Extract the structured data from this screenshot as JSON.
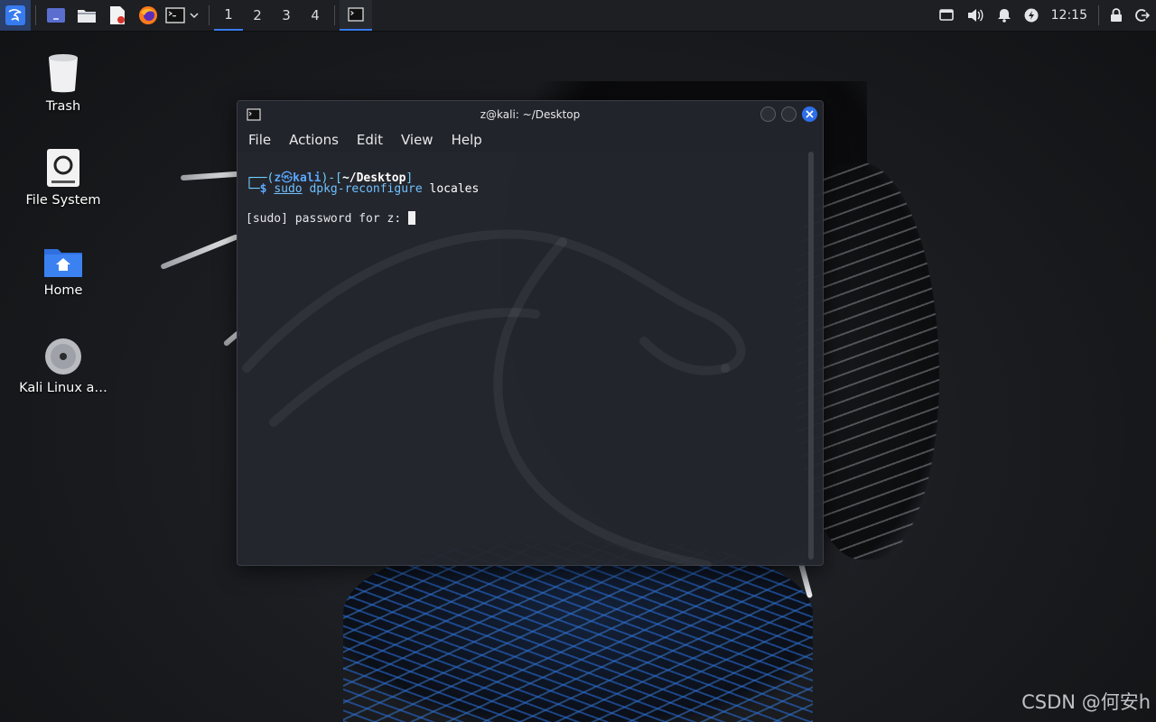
{
  "panel": {
    "workspaces": [
      "1",
      "2",
      "3",
      "4"
    ],
    "active_workspace": "1",
    "clock": "12:15",
    "accent": "#367bf0"
  },
  "desktop": {
    "icons": [
      {
        "label": "Trash",
        "icon": "trash-icon"
      },
      {
        "label": "File System",
        "icon": "drive-icon"
      },
      {
        "label": "Home",
        "icon": "home-folder-icon"
      },
      {
        "label": "Kali Linux a…",
        "icon": "disc-icon"
      }
    ]
  },
  "terminal": {
    "title": "z@kali: ~/Desktop",
    "menu": [
      "File",
      "Actions",
      "Edit",
      "View",
      "Help"
    ],
    "prompt": {
      "open": "┌──(",
      "user": "z",
      "skull": "㉿",
      "host": "kali",
      "mid": ")-[",
      "path": "~/Desktop",
      "close": "]",
      "corner": "└─",
      "dollar": "$",
      "cmd": "sudo",
      "args": "dpkg-reconfigure",
      "rest": "locales"
    },
    "output": "[sudo] password for z: "
  },
  "watermark": "CSDN @何安h"
}
